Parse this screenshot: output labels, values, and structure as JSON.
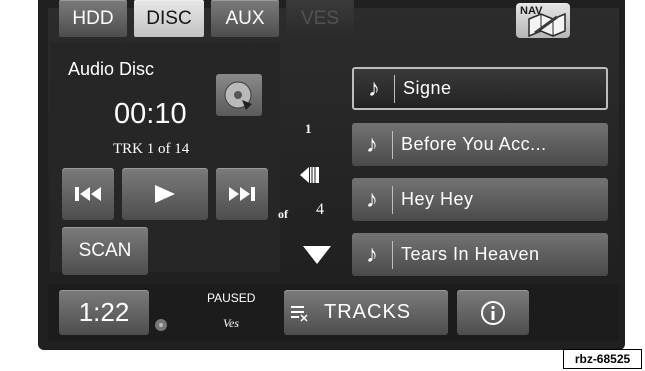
{
  "tabs": [
    {
      "label": "HDD",
      "state": "normal"
    },
    {
      "label": "DISC",
      "state": "active"
    },
    {
      "label": "AUX",
      "state": "normal"
    },
    {
      "label": "VES",
      "state": "disabled"
    }
  ],
  "nav": {
    "label": "NAV"
  },
  "now_playing": {
    "source": "Audio Disc",
    "elapsed": "00:10",
    "track_info": "TRK 1 of 14"
  },
  "controls": {
    "scan_label": "SCAN"
  },
  "track_list": {
    "current": "1",
    "of_label": "of",
    "total": "4",
    "items": [
      {
        "name": "Signe",
        "selected": true
      },
      {
        "name": "Before You Acc...",
        "selected": false
      },
      {
        "name": "Hey Hey",
        "selected": false
      },
      {
        "name": "Tears In Heaven",
        "selected": false
      }
    ]
  },
  "bottom": {
    "clock": "1:22",
    "status": "PAUSED",
    "ves_status": "Ves",
    "tracks_label": "TRACKS"
  },
  "reference_code": "rbz-68525",
  "colors": {
    "background": "#1d1d1d",
    "button": "#5e5e5e",
    "active_tab": "#d6d6d6",
    "text": "#ffffff"
  }
}
